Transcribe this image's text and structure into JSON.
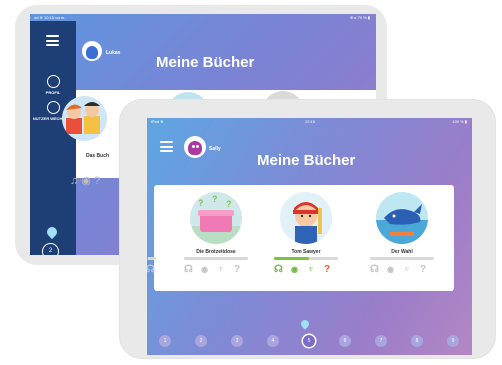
{
  "back_tablet": {
    "statusbar": {
      "left": "ad ≋ 10:15 vorm.",
      "right": "⊕ ▸ 70 % ▮"
    },
    "sidebar": {
      "items": [
        {
          "label": "PROFIL"
        },
        {
          "label": "NUTZER WECHSELN"
        }
      ],
      "page_number": "2"
    },
    "user": "Lukas",
    "title": "Meine Bücher",
    "books": [
      {
        "title": "Das Buch"
      }
    ],
    "icons": "♫ ◉ ?"
  },
  "front_tablet": {
    "statusbar": {
      "left": "iPad ≋",
      "center": "22:15",
      "right": "100 % ▮"
    },
    "user": "Sally",
    "title": "Meine Bücher",
    "books": [
      {
        "title": "",
        "progress": 0.15
      },
      {
        "title": "Die Brotzeitdose",
        "progress": 0
      },
      {
        "title": "Tom Sawyer",
        "progress": 0.55
      },
      {
        "title": "Der Wahl",
        "progress": 0
      }
    ],
    "pages": [
      "1",
      "2",
      "3",
      "4",
      "5",
      "6",
      "7",
      "8",
      "9"
    ],
    "current_page": 5
  }
}
